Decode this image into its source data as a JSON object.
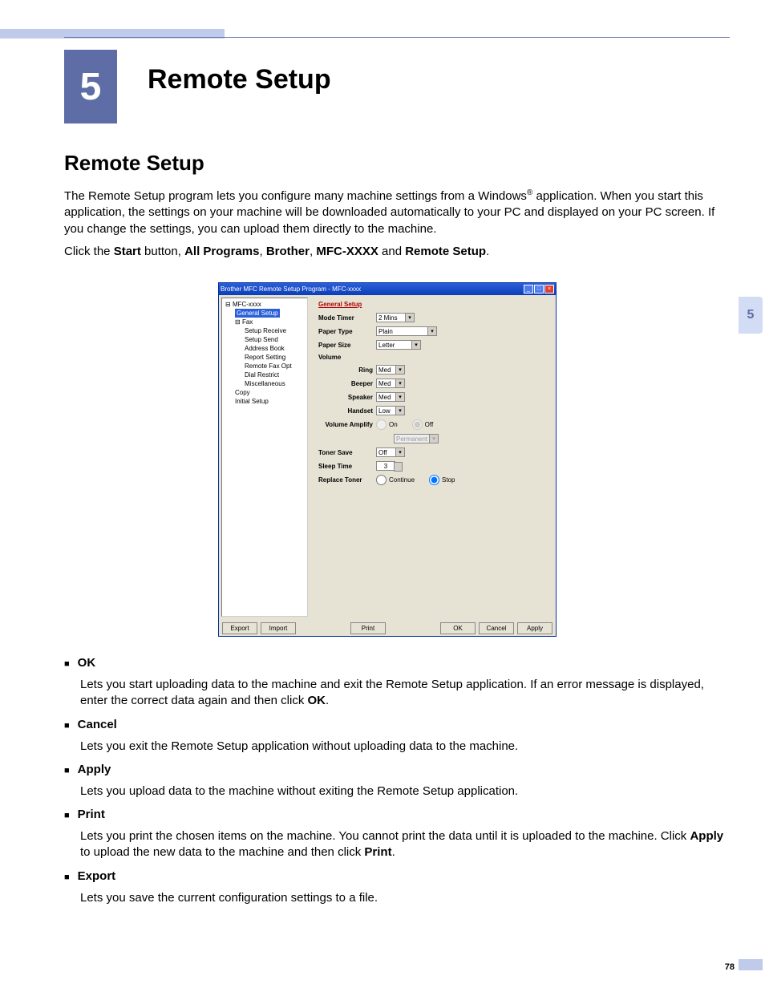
{
  "chapter": {
    "number": "5",
    "title": "Remote Setup"
  },
  "section_title": "Remote Setup",
  "para1_a": "The Remote Setup program lets you configure many machine settings from a Windows",
  "para1_sup": "®",
  "para1_b": " application. When you start this application, the settings on your machine will be downloaded automatically to your PC and displayed on your PC screen. If you change the settings, you can upload them directly to the machine.",
  "para2_pre": "Click the ",
  "para2_b1": "Start",
  "para2_mid1": " button, ",
  "para2_b2": "All Programs",
  "para2_mid2": ", ",
  "para2_b3": "Brother",
  "para2_mid3": ", ",
  "para2_b4": "MFC-XXXX",
  "para2_mid4": " and ",
  "para2_b5": "Remote Setup",
  "para2_end": ".",
  "side_tab": "5",
  "page_number": "78",
  "app": {
    "title": "Brother MFC Remote Setup Program - MFC-xxxx",
    "tree": {
      "root": "MFC-xxxx",
      "general": "General Setup",
      "fax": "Fax",
      "fax_children": [
        "Setup Receive",
        "Setup Send",
        "Address Book",
        "Report Setting",
        "Remote Fax Opt",
        "Dial Restrict",
        "Miscellaneous"
      ],
      "copy": "Copy",
      "initial": "Initial Setup"
    },
    "pane": {
      "title": "General Setup",
      "mode_timer": {
        "label": "Mode Timer",
        "value": "2 Mins"
      },
      "paper_type": {
        "label": "Paper Type",
        "value": "Plain"
      },
      "paper_size": {
        "label": "Paper Size",
        "value": "Letter"
      },
      "volume": {
        "label": "Volume"
      },
      "ring": {
        "label": "Ring",
        "value": "Med"
      },
      "beeper": {
        "label": "Beeper",
        "value": "Med"
      },
      "speaker": {
        "label": "Speaker",
        "value": "Med"
      },
      "handset": {
        "label": "Handset",
        "value": "Low"
      },
      "vol_amp": {
        "label": "Volume Amplify",
        "on": "On",
        "off": "Off"
      },
      "vol_amp_disabled": "Permanent",
      "toner_save": {
        "label": "Toner Save",
        "value": "Off"
      },
      "sleep_time": {
        "label": "Sleep Time",
        "value": "3"
      },
      "replace_toner": {
        "label": "Replace Toner",
        "continue": "Continue",
        "stop": "Stop"
      }
    },
    "footer": {
      "export": "Export",
      "import": "Import",
      "print": "Print",
      "ok": "OK",
      "cancel": "Cancel",
      "apply": "Apply"
    }
  },
  "bullets": [
    {
      "label": "OK",
      "desc_pre": "Lets you start uploading data to the machine and exit the Remote Setup application. If an error message is displayed, enter the correct data again and then click ",
      "desc_b": "OK",
      "desc_post": "."
    },
    {
      "label": "Cancel",
      "desc_pre": "Lets you exit the Remote Setup application without uploading data to the machine.",
      "desc_b": "",
      "desc_post": ""
    },
    {
      "label": "Apply",
      "desc_pre": "Lets you upload data to the machine without exiting the Remote Setup application.",
      "desc_b": "",
      "desc_post": ""
    },
    {
      "label": "Print",
      "desc_pre": "Lets you print the chosen items on the machine. You cannot print the data until it is uploaded to the machine. Click ",
      "desc_b": "Apply",
      "desc_mid": " to upload the new data to the machine and then click ",
      "desc_b2": "Print",
      "desc_post": "."
    },
    {
      "label": "Export",
      "desc_pre": "Lets you save the current configuration settings to a file.",
      "desc_b": "",
      "desc_post": ""
    }
  ]
}
